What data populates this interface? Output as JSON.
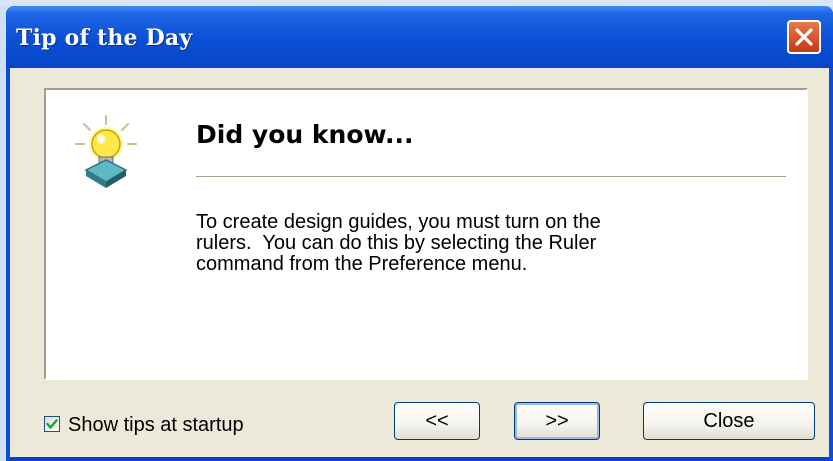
{
  "window": {
    "title": "Tip of the Day"
  },
  "tip": {
    "heading": "Did you know...",
    "lines": [
      "To create design guides, you must turn on the",
      "rulers.  You can do this by selecting the Ruler",
      "command from the Preference menu."
    ]
  },
  "footer": {
    "show_tips_label": "Show tips at startup",
    "show_tips_checked": true,
    "prev_label": "<<",
    "next_label": ">>",
    "close_label": "Close"
  },
  "icons": {
    "titlebar_close": "close-icon",
    "tip": "lightbulb-icon",
    "checkbox": "checkmark-icon"
  },
  "colors": {
    "titlebar": "#0a4fd6",
    "close_button": "#d8532a",
    "client_background": "#ece9d8",
    "panel_background": "#ffffff",
    "checkmark": "#21a121"
  }
}
